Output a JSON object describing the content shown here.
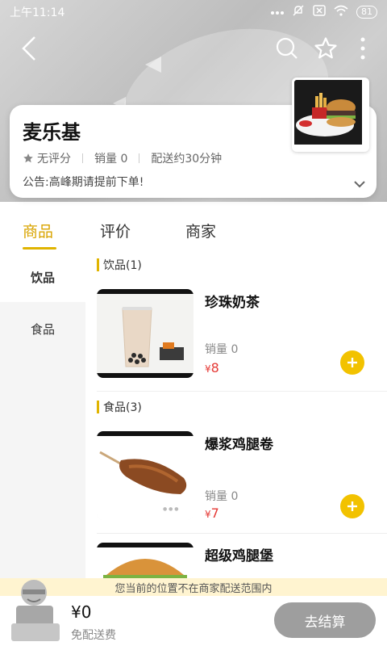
{
  "status_bar": {
    "time": "上午11:14",
    "battery": "81"
  },
  "store": {
    "name": "麦乐基",
    "rating": "无评分",
    "sales": "销量 0",
    "delivery": "配送约30分钟",
    "notice": "公告:高峰期请提前下单!"
  },
  "tabs": [
    "商品",
    "评价",
    "商家"
  ],
  "categories": [
    "饮品",
    "食品"
  ],
  "sections": [
    {
      "title": "饮品(1)"
    },
    {
      "title": "食品(3)"
    }
  ],
  "products": [
    {
      "name": "珍珠奶茶",
      "sales": "销量 0",
      "currency": "¥",
      "price": "8"
    },
    {
      "name": "爆浆鸡腿卷",
      "sales": "销量 0",
      "currency": "¥",
      "price": "7"
    },
    {
      "name": "超级鸡腿堡"
    }
  ],
  "bottom": {
    "range_notice": "您当前的位置不在商家配送范围内",
    "total": "¥0",
    "delivery_fee": "免配送费",
    "checkout": "去结算"
  },
  "colors": {
    "accent": "#e0b400",
    "price": "#e53935",
    "add_button": "#f2c200",
    "checkout_disabled": "#9e9e9e"
  }
}
